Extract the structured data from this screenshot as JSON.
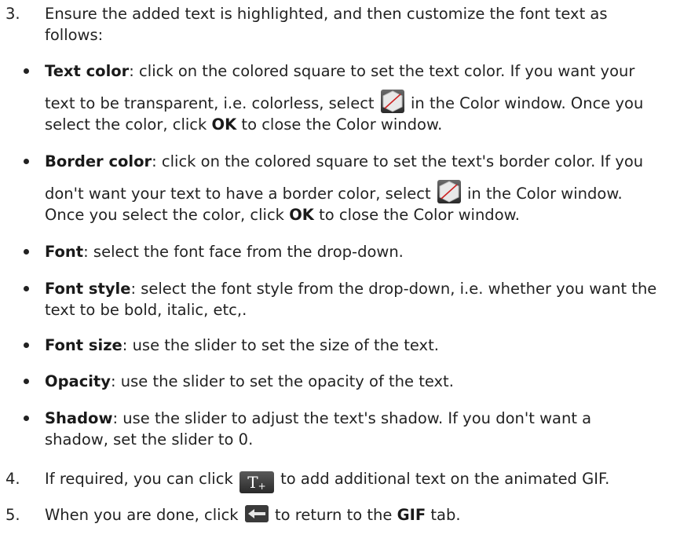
{
  "steps": {
    "s3": {
      "num": "3.",
      "line1": "Ensure the added text is highlighted, and then customize the font text as",
      "line2": "follows:"
    },
    "s4": {
      "num": "4.",
      "before": "If required, you can click",
      "after": "to add additional text on the animated GIF.",
      "button_icon": "add-text-icon",
      "button_glyph": "T",
      "button_sub": "+"
    },
    "s5": {
      "num": "5.",
      "before": "When you are done, click",
      "after": "to return to the",
      "bold": "GIF",
      "end": "tab.",
      "button_icon": "back-arrow-icon"
    }
  },
  "bullets": {
    "text_color": {
      "term": "Text color",
      "l1": ": click on the colored square to set the text color. If you want your",
      "l2a": "text to be transparent, i.e. colorless, select",
      "l2b": "in the Color window. Once you",
      "l3a": "select the color, click",
      "l3b": "OK",
      "l3c": "to close the Color window."
    },
    "border_color": {
      "term": "Border color",
      "l1": ": click on the colored square to set the text's border color. If you",
      "l2a": "don't want your text to have a border color, select",
      "l2b": "in the Color window.",
      "l3a": "Once you select the color, click",
      "l3b": "OK",
      "l3c": "to close the Color window."
    },
    "font": {
      "term": "Font",
      "l1": ": select the font face from the drop-down."
    },
    "font_style": {
      "term": "Font style",
      "l1": ": select the font style from the drop-down, i.e. whether you want the",
      "l2": "text to be bold, italic, etc,."
    },
    "font_size": {
      "term": "Font size",
      "l1": ": use the slider to set the size of the text."
    },
    "opacity": {
      "term": "Opacity",
      "l1": ": use the slider to set the opacity of the text."
    },
    "shadow": {
      "term": "Shadow",
      "l1": ": use the slider to adjust the text's shadow. If you don't want a",
      "l2": "shadow, set the slider to 0."
    }
  },
  "icons": {
    "no_color": "no-color-icon",
    "no_color_fill": "#4a4a4a",
    "no_color_slash": "#cc2222"
  }
}
